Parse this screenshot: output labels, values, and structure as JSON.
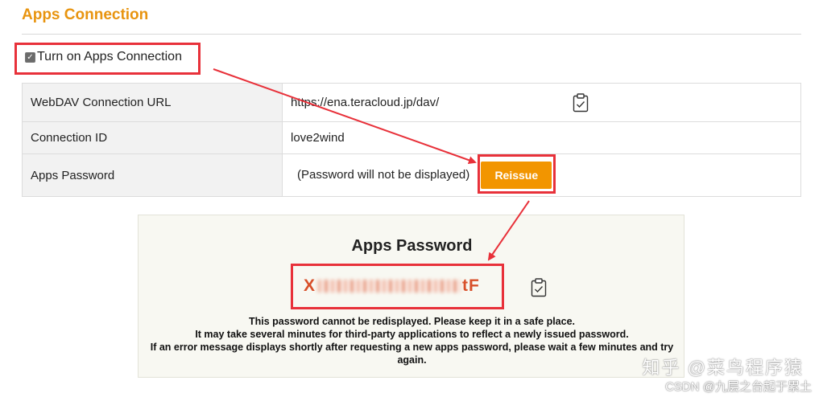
{
  "section": {
    "title": "Apps Connection"
  },
  "toggle": {
    "label": "Turn on Apps Connection",
    "checked": true,
    "check_glyph": "✓"
  },
  "settings": {
    "rows": [
      {
        "label": "WebDAV Connection URL",
        "value": "https://ena.teracloud.jp/dav/"
      },
      {
        "label": "Connection ID",
        "value": "love2wind"
      },
      {
        "label": "Apps Password",
        "value": "(Password will not be displayed)"
      }
    ],
    "reissue_label": "Reissue"
  },
  "password_panel": {
    "title": "Apps Password",
    "value_start": "X",
    "value_end": "tF",
    "notes": [
      "This password cannot be redisplayed. Please keep it in a safe place.",
      "It may take several minutes for third-party applications to reflect a newly issued password.",
      "If an error message displays shortly after requesting a new apps password, please wait a few minutes and try again."
    ]
  },
  "watermark": {
    "line1": "知乎 @菜鸟程序猿",
    "line2": "CSDN @九层之台起于累土"
  },
  "colors": {
    "accent": "#e8940f",
    "button": "#f29500",
    "highlight": "#e8313a",
    "password": "#d8502a"
  },
  "icons": {
    "copy": "clipboard-check-icon"
  }
}
